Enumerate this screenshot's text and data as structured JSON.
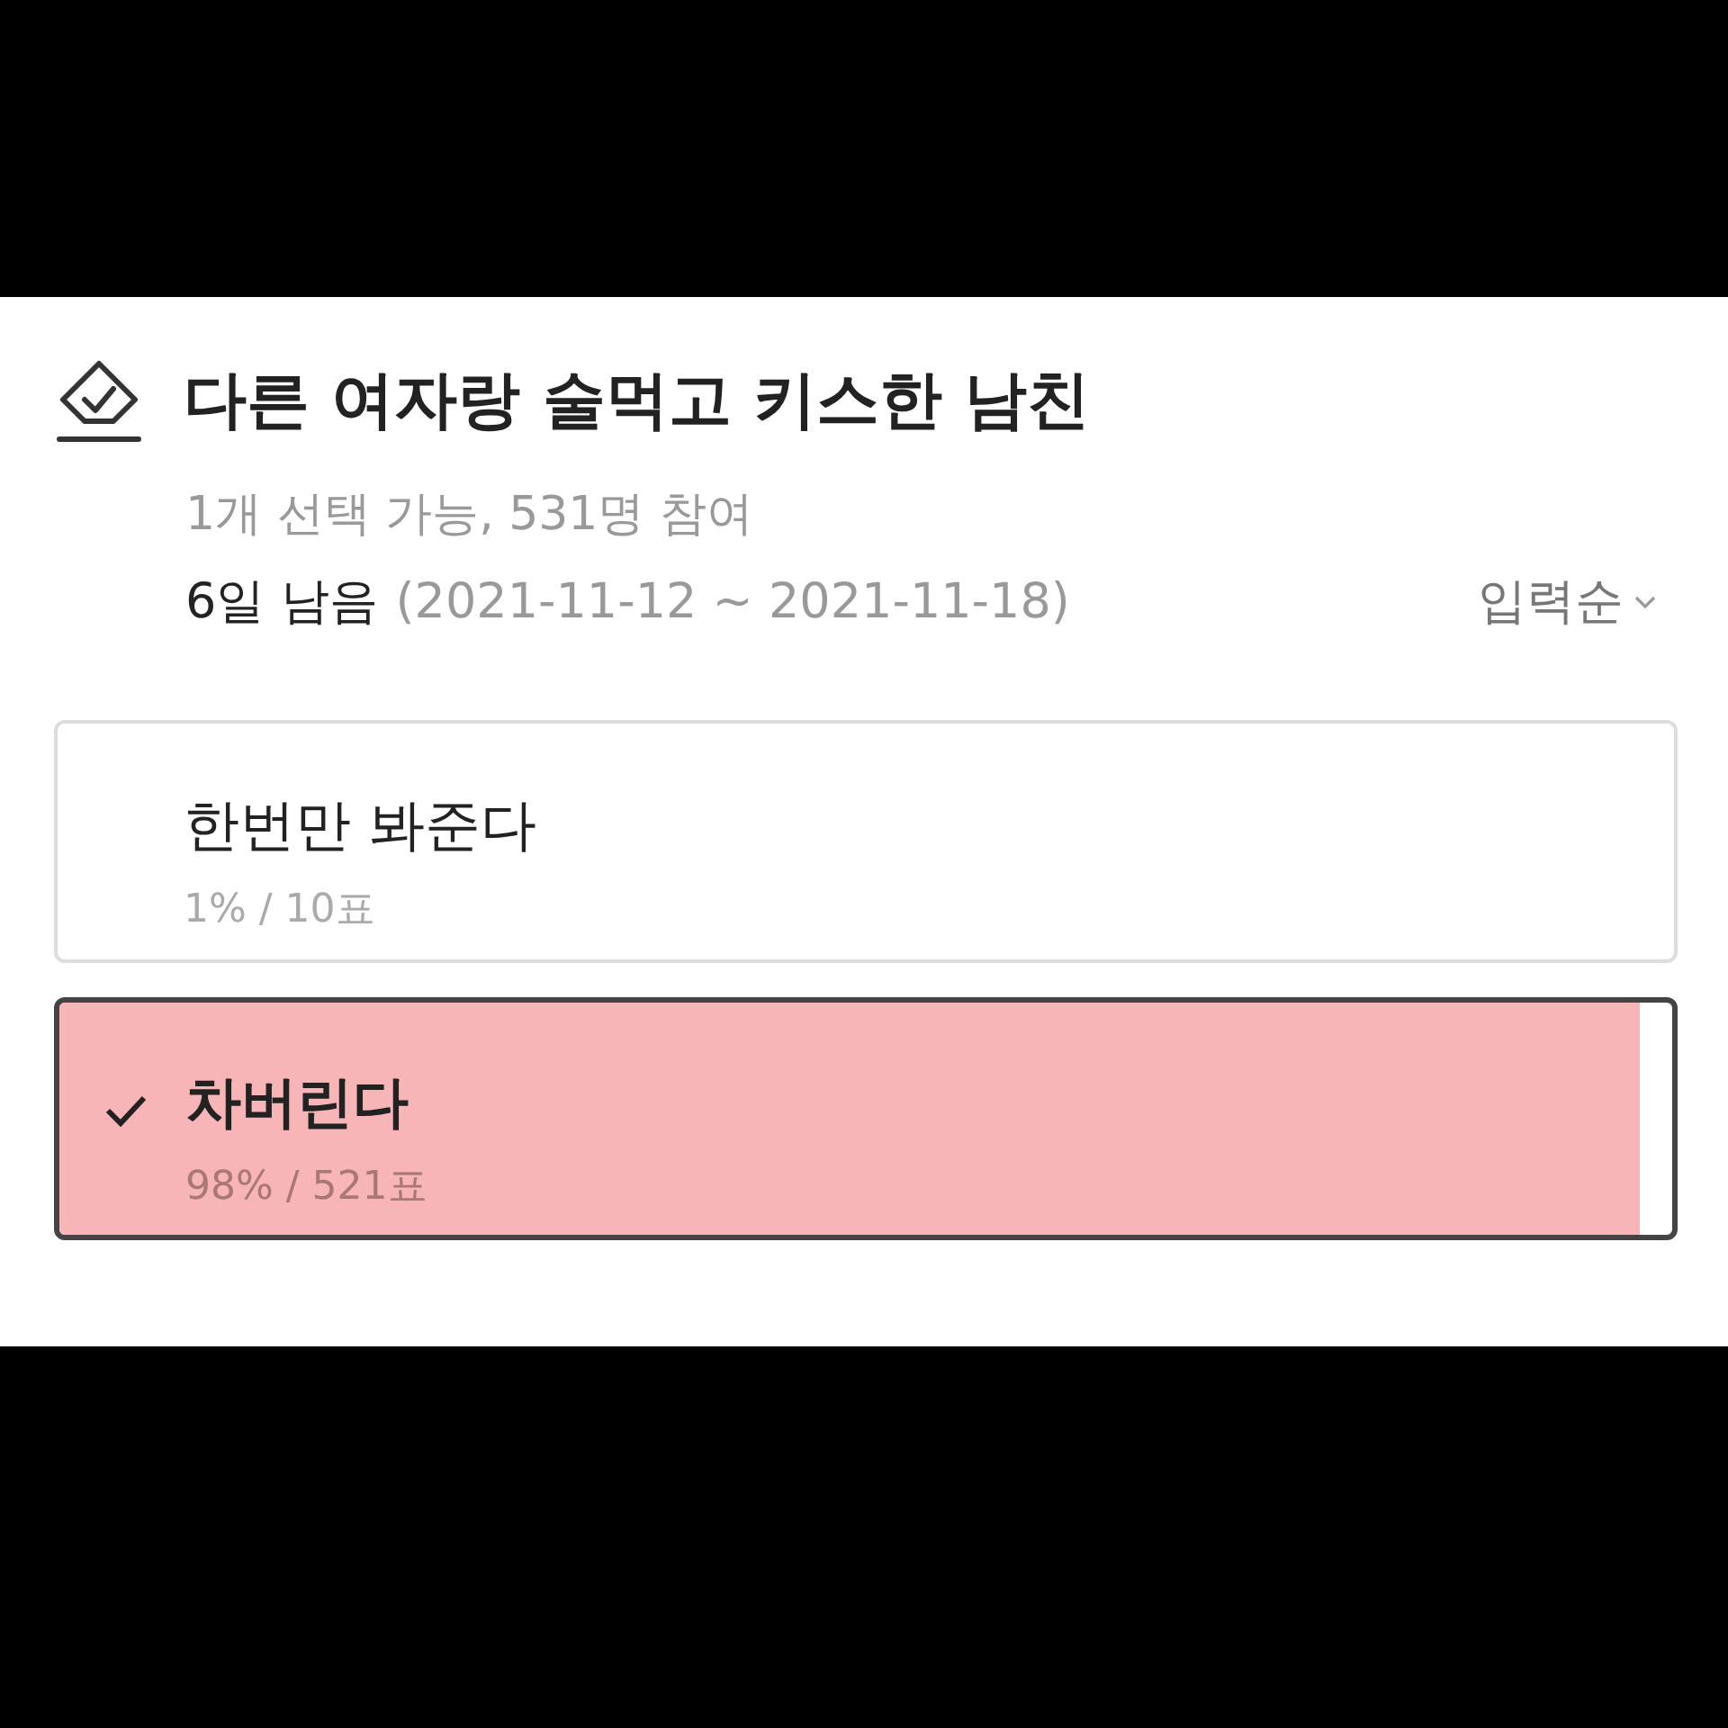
{
  "poll": {
    "title": "다른 여자랑 술먹고 키스한 남친",
    "info": "1개 선택 가능, 531명 참여",
    "remaining": "6일 남음",
    "period": "(2021-11-12 ~ 2021-11-18)",
    "sort": "입력순"
  },
  "options": [
    {
      "label": "한번만 봐준다",
      "result": "1% / 10표",
      "selected": false
    },
    {
      "label": "차버린다",
      "result": "98% / 521표",
      "selected": true,
      "level": 0.98
    }
  ]
}
